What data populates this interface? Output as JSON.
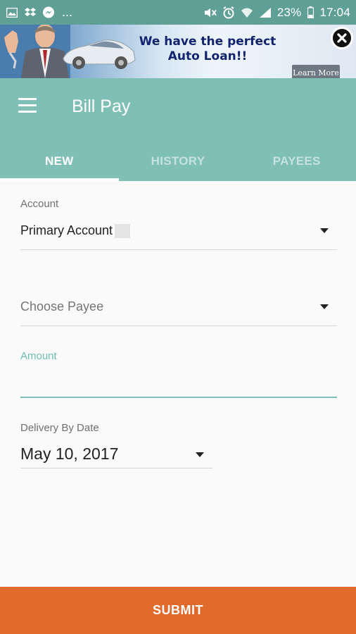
{
  "status_bar": {
    "icons_left": [
      "image-icon",
      "dropbox-icon",
      "messenger-icon"
    ],
    "overflow": "...",
    "icons_right": [
      "mute-icon",
      "alarm-icon",
      "wifi-icon",
      "signal-icon",
      "battery-icon"
    ],
    "battery": "23%",
    "time": "17:04"
  },
  "ad": {
    "headline_line1": "We have the perfect",
    "headline_line2": "Auto Loan!!",
    "cta": "Learn More",
    "text_color": "#12246f"
  },
  "app_bar": {
    "title": "Bill Pay",
    "color": "#7fbfb6"
  },
  "tabs": [
    {
      "label": "NEW",
      "active": true
    },
    {
      "label": "HISTORY",
      "active": false
    },
    {
      "label": "PAYEES",
      "active": false
    }
  ],
  "form": {
    "account": {
      "label": "Account",
      "value": "Primary Account"
    },
    "payee": {
      "placeholder": "Choose Payee"
    },
    "amount": {
      "label": "Amount",
      "value": "",
      "accent": "#7fbfb6"
    },
    "delivery": {
      "label": "Delivery By Date",
      "value": "May 10, 2017"
    }
  },
  "submit": {
    "label": "SUBMIT",
    "color": "#e06a2a"
  }
}
